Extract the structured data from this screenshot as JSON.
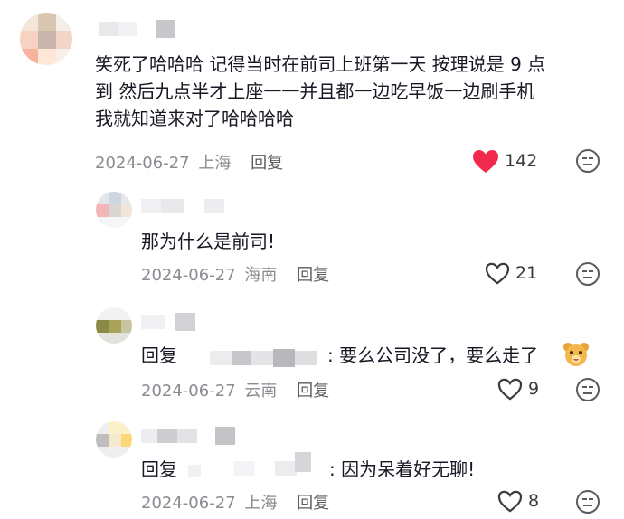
{
  "comments": [
    {
      "text_line1": "笑死了哈哈哈 记得当时在前司上班第一天 按理说是 9 点",
      "text_line2": "到 然后九点半才上座一一并且都一边吃早饭一边刷手机",
      "text_line3": "我就知道来对了哈哈哈哈",
      "date": "2024-06-27",
      "location": "上海",
      "reply_label": "回复",
      "likes": "142",
      "liked": true
    }
  ],
  "replies": [
    {
      "text": "那为什么是前司!",
      "date": "2024-06-27",
      "location": "海南",
      "reply_label": "回复",
      "likes": "21"
    },
    {
      "prefix": "回复",
      "text": ": 要么公司没了，要么走了",
      "date": "2024-06-27",
      "location": "云南",
      "reply_label": "回复",
      "likes": "9"
    },
    {
      "prefix": "回复",
      "text": ": 因为呆着好无聊!",
      "date": "2024-06-27",
      "location": "上海",
      "reply_label": "回复",
      "likes": "8"
    }
  ],
  "icons": {
    "like": "heart-icon",
    "dislike": "meh-face-icon",
    "emoji": "bear-face-emoji"
  },
  "colors": {
    "heart": "#f0294d",
    "meta": "#8a8b91",
    "text": "#161823"
  }
}
